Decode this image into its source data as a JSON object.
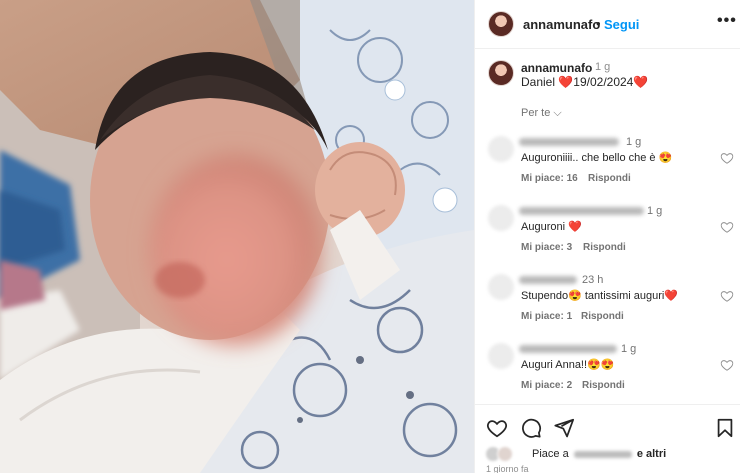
{
  "post": {
    "username": "annamunafo",
    "separator": "•",
    "follow_label": "Segui",
    "more_label": "•••",
    "caption_username": "annamunafo",
    "caption_age": "1 g",
    "caption_text": "Daniel ❤️19/02/2024❤️",
    "translate_label": "Per te ⌵"
  },
  "comments": [
    {
      "age": "1 g",
      "text": "Auguroniiii.. che bello che è 😍",
      "likes": "Mi piace: 16",
      "reply": "Rispondi"
    },
    {
      "age": "1 g",
      "text": "Auguroni ❤️",
      "likes": "Mi piace: 3",
      "reply": "Rispondi"
    },
    {
      "age": "23 h",
      "text": "Stupendo😍 tantissimi auguri❤️",
      "likes": "Mi piace: 1",
      "reply": "Rispondi"
    },
    {
      "age": "1 g",
      "text": "Auguri Anna!!😍😍",
      "likes": "Mi piace: 2",
      "reply": "Rispondi"
    }
  ],
  "footer": {
    "likes_prefix": "Piace a",
    "likes_suffix": "e altri",
    "timestamp": "1 giorno fa"
  },
  "icons": {
    "like": "heart-icon",
    "comment": "comment-icon",
    "share": "paper-plane-icon",
    "save": "bookmark-icon",
    "comment_like": "heart-outline-icon",
    "more": "more-options-icon"
  },
  "colors": {
    "follow": "#0095f6",
    "text": "#262626",
    "secondary": "#737373",
    "heart_emoji": "#e8202b"
  }
}
